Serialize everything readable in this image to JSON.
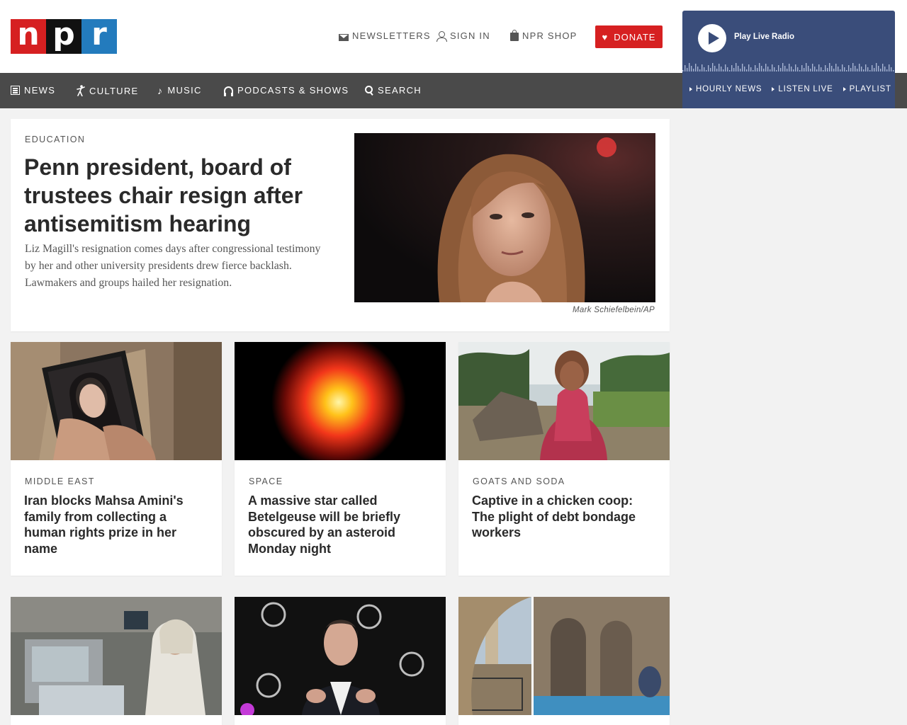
{
  "header": {
    "logo": {
      "n": "n",
      "p": "p",
      "r": "r"
    },
    "newsletters": "Newsletters",
    "sign_in": "Sign In",
    "shop": "NPR Shop",
    "donate": "Donate"
  },
  "nav": {
    "news": "News",
    "culture": "Culture",
    "music": "Music",
    "podcasts": "Podcasts & Shows",
    "search": "Search"
  },
  "radio": {
    "play_label": "Play Live Radio",
    "links": [
      "Hourly News",
      "Listen Live",
      "Playlist"
    ]
  },
  "feature": {
    "slug": "Education",
    "title": "Penn president, board of trustees chair resign after antisemitism hearing",
    "teaser": "Liz Magill's resignation comes days after congressional testimony by her and other university presidents drew fierce backlash. Lawmakers and groups hailed her resignation.",
    "credit": "Mark Schiefelbein/AP"
  },
  "stories": [
    {
      "slug": "Middle East",
      "title": "Iran blocks Mahsa Amini's family from collecting a human rights prize in her name"
    },
    {
      "slug": "Space",
      "title": "A massive star called Betelgeuse will be briefly obscured by an asteroid Monday night"
    },
    {
      "slug": "Goats and Soda",
      "title": "Captive in a chicken coop: The plight of debt bondage workers"
    }
  ],
  "colors": {
    "brand_red": "#d62021",
    "brand_blue": "#237bbd",
    "nav_bg": "#4a4a4a",
    "radio_bg": "#3a4d7a"
  }
}
